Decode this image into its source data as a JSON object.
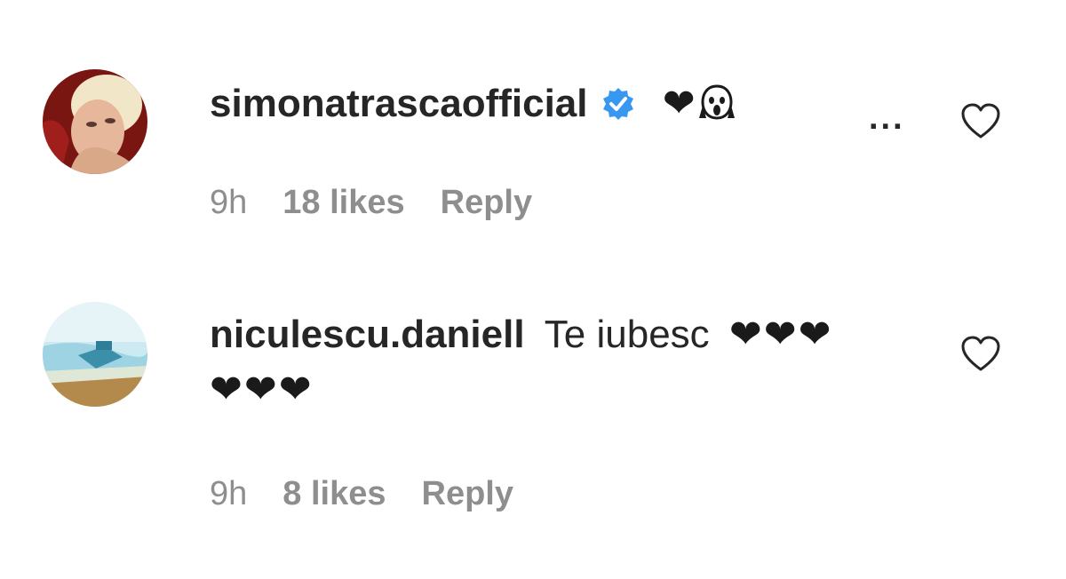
{
  "comments": [
    {
      "username": "simonatrascaofficial",
      "text": "",
      "emoji": "❤",
      "verified": true,
      "time": "9h",
      "likes": "18 likes",
      "reply": "Reply",
      "more": "...",
      "icons": {
        "like": "heart-outline-icon",
        "verified": "verified-badge-icon"
      },
      "colors": {
        "verified": "#3897f0"
      }
    },
    {
      "username": "niculescu.daniell",
      "text": "Te iubesc",
      "emoji_line1": "❤❤❤",
      "emoji_line2": "❤❤❤",
      "time": "9h",
      "likes": "8 likes",
      "reply": "Reply",
      "icons": {
        "like": "heart-outline-icon"
      }
    }
  ],
  "colors": {
    "text": "#262626",
    "meta": "#8e8e8e"
  }
}
